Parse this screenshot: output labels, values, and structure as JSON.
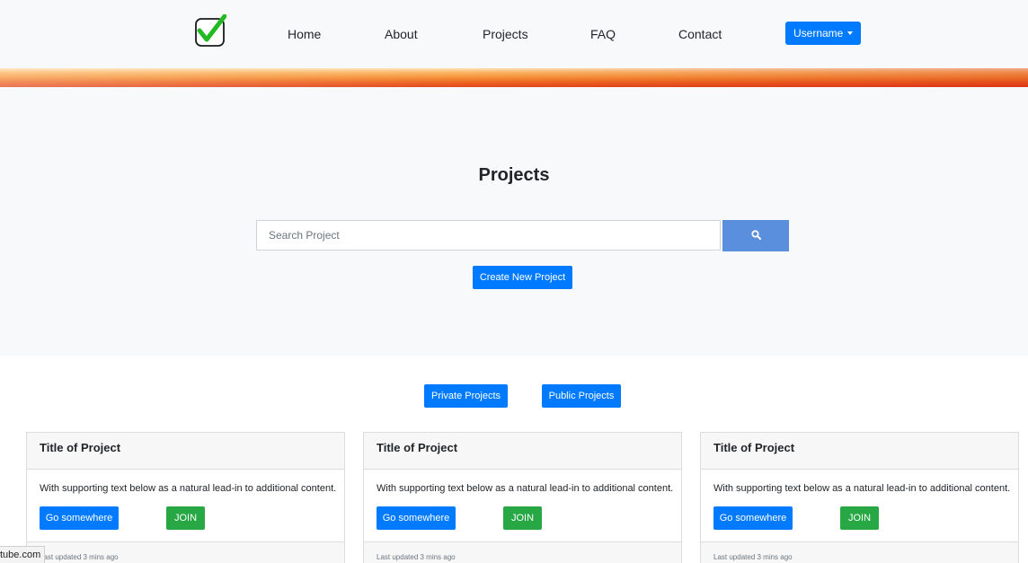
{
  "nav": {
    "logo_icon": "checkmark-logo-icon",
    "links": [
      "Home",
      "About",
      "Projects",
      "FAQ",
      "Contact"
    ],
    "user_button": "Username"
  },
  "hero": {
    "title": "Projects",
    "search_placeholder": "Search Project",
    "search_icon": "search-icon",
    "create_button": "Create New Project"
  },
  "filters": {
    "private": "Private Projects",
    "public": "Public Projects"
  },
  "cards": [
    {
      "title": "Title of Project",
      "text": "With supporting text below as a natural lead-in to additional content.",
      "go_button": "Go somewhere",
      "join_button": "JOIN",
      "updated": "Last updated 3 mins ago"
    },
    {
      "title": "Title of Project",
      "text": "With supporting text below as a natural lead-in to additional content.",
      "go_button": "Go somewhere",
      "join_button": "JOIN",
      "updated": "Last updated 3 mins ago"
    },
    {
      "title": "Title of Project",
      "text": "With supporting text below as a natural lead-in to additional content.",
      "go_button": "Go somewhere",
      "join_button": "JOIN",
      "updated": "Last updated 3 mins ago"
    }
  ],
  "status_bar": {
    "url_text": "tube.com"
  },
  "colors": {
    "primary": "#007bff",
    "success": "#28a745",
    "search_button": "#5a8fdd",
    "light_bg": "#f8f9fa"
  }
}
